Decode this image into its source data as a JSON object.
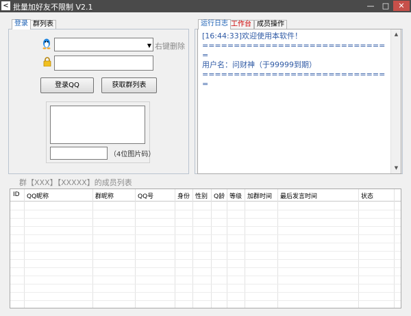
{
  "window": {
    "title": "批量加好友不限制 V2.1"
  },
  "left_tabs": [
    {
      "label": "登录"
    },
    {
      "label": "群列表"
    }
  ],
  "login": {
    "account_hint": "右键删除",
    "login_button": "登录QQ",
    "fetch_groups_button": "获取群列表",
    "captcha_hint": "（4位图片码）",
    "account_value": "",
    "password_value": "",
    "captcha_value": ""
  },
  "right_tabs": [
    {
      "label": "运行日志"
    },
    {
      "label": "工作台"
    },
    {
      "label": "成员操作"
    }
  ],
  "log": {
    "lines": [
      "[16:44:33]欢迎使用本软件！",
      "==============================",
      "用户名：问财神（于99999到期）",
      "=============================="
    ]
  },
  "members_title": "群【XXX】【XXXXX】的成员列表",
  "table": {
    "columns": [
      "ID",
      "QQ昵称",
      "群昵称",
      "QQ号",
      "身份",
      "性别",
      "Q龄",
      "等级",
      "加群时间",
      "最后发言时间",
      "状态"
    ],
    "rows": []
  },
  "colors": {
    "log_text": "#2f5aa5",
    "title_bar": "#4a4a4a",
    "close_button": "#c7504a",
    "active_tab_text": "#1a5fb4",
    "workbench_tab_text": "#cc0000"
  },
  "icons": {
    "account": "qq-penguin-icon",
    "password": "lock-icon"
  }
}
